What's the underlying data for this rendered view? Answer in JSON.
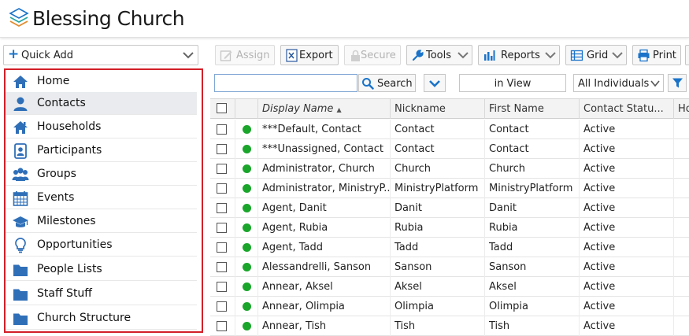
{
  "app": {
    "title": "Blessing Church"
  },
  "colors": {
    "accent": "#1a73c9",
    "active_dot": "#1aa52b",
    "highlight_border": "#d21f28"
  },
  "sidebar": {
    "quick_add": "Quick Add",
    "items": [
      {
        "label": "Home",
        "icon": "home-icon"
      },
      {
        "label": "Contacts",
        "icon": "contact-icon"
      },
      {
        "label": "Households",
        "icon": "household-icon"
      },
      {
        "label": "Participants",
        "icon": "participant-icon"
      },
      {
        "label": "Groups",
        "icon": "groups-icon"
      },
      {
        "label": "Events",
        "icon": "calendar-icon"
      },
      {
        "label": "Milestones",
        "icon": "graduation-cap-icon"
      },
      {
        "label": "Opportunities",
        "icon": "lightbulb-icon"
      },
      {
        "label": "People Lists",
        "icon": "folder-icon"
      },
      {
        "label": "Staff Stuff",
        "icon": "folder-icon"
      },
      {
        "label": "Church Structure",
        "icon": "folder-icon"
      }
    ],
    "active_index": 1
  },
  "toolbar": {
    "assign": "Assign",
    "export": "Export",
    "secure": "Secure",
    "tools": "Tools",
    "reports": "Reports",
    "grid": "Grid",
    "print": "Print"
  },
  "search": {
    "value": "",
    "button": "Search",
    "view": "in View",
    "filter_select": "All Individuals"
  },
  "grid": {
    "columns": [
      "Display Name",
      "Nickname",
      "First Name",
      "Contact Statu...",
      "Ho"
    ],
    "sort_indicator": "▲",
    "rows": [
      {
        "display_name": "***Default, Contact",
        "nickname": "Contact",
        "first_name": "Contact",
        "status": "Active"
      },
      {
        "display_name": "***Unassigned, Contact",
        "nickname": "Contact",
        "first_name": "Contact",
        "status": "Active"
      },
      {
        "display_name": "Administrator, Church",
        "nickname": "Church",
        "first_name": "Church",
        "status": "Active"
      },
      {
        "display_name": "Administrator, MinistryP...",
        "nickname": "MinistryPlatform",
        "first_name": "MinistryPlatform",
        "status": "Active"
      },
      {
        "display_name": "Agent, Danit",
        "nickname": "Danit",
        "first_name": "Danit",
        "status": "Active"
      },
      {
        "display_name": "Agent, Rubia",
        "nickname": "Rubia",
        "first_name": "Rubia",
        "status": "Active"
      },
      {
        "display_name": "Agent, Tadd",
        "nickname": "Tadd",
        "first_name": "Tadd",
        "status": "Active"
      },
      {
        "display_name": "Alessandrelli, Sanson",
        "nickname": "Sanson",
        "first_name": "Sanson",
        "status": "Active"
      },
      {
        "display_name": "Annear, Aksel",
        "nickname": "Aksel",
        "first_name": "Aksel",
        "status": "Active"
      },
      {
        "display_name": "Annear, Olimpia",
        "nickname": "Olimpia",
        "first_name": "Olimpia",
        "status": "Active"
      },
      {
        "display_name": "Annear, Tish",
        "nickname": "Tish",
        "first_name": "Tish",
        "status": "Active"
      }
    ]
  }
}
